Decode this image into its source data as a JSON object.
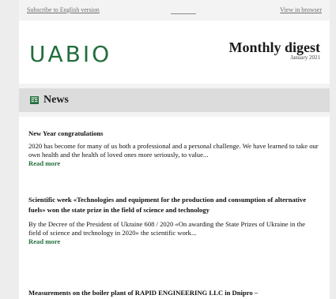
{
  "topbar": {
    "subscribe_link": "Subscribe to English version",
    "browser_link": "View in browser"
  },
  "header": {
    "logo_text": "UABIO",
    "title": "Monthly digest",
    "date": "January 2021"
  },
  "section": {
    "icon": "newspaper-icon",
    "title": "News"
  },
  "news": [
    {
      "title": "New Year congratulations",
      "body": "2020 has become for many of us both a professional and a personal challenge. We have learned to take our own health and the health of loved ones more seriously, to value...",
      "read_more": "Read more"
    },
    {
      "title": "Scientific week «Technologies and equipment for the production and consumption of alternative fuels» won the state prize in the field of science and technology",
      "body": "By the Decree of the President of Ukraine 608 / 2020 «On awarding the State Prizes of Ukraine in the field of science and technology in 2020» the scientific work...",
      "read_more": "Read more"
    },
    {
      "title": "Measurements on the boiler plant of RAPID ENGINEERING LLC in Dnipro –"
    }
  ],
  "colors": {
    "brand_green": "#226e3c",
    "section_bg": "#dcdcdc",
    "page_bg": "#ededed"
  }
}
